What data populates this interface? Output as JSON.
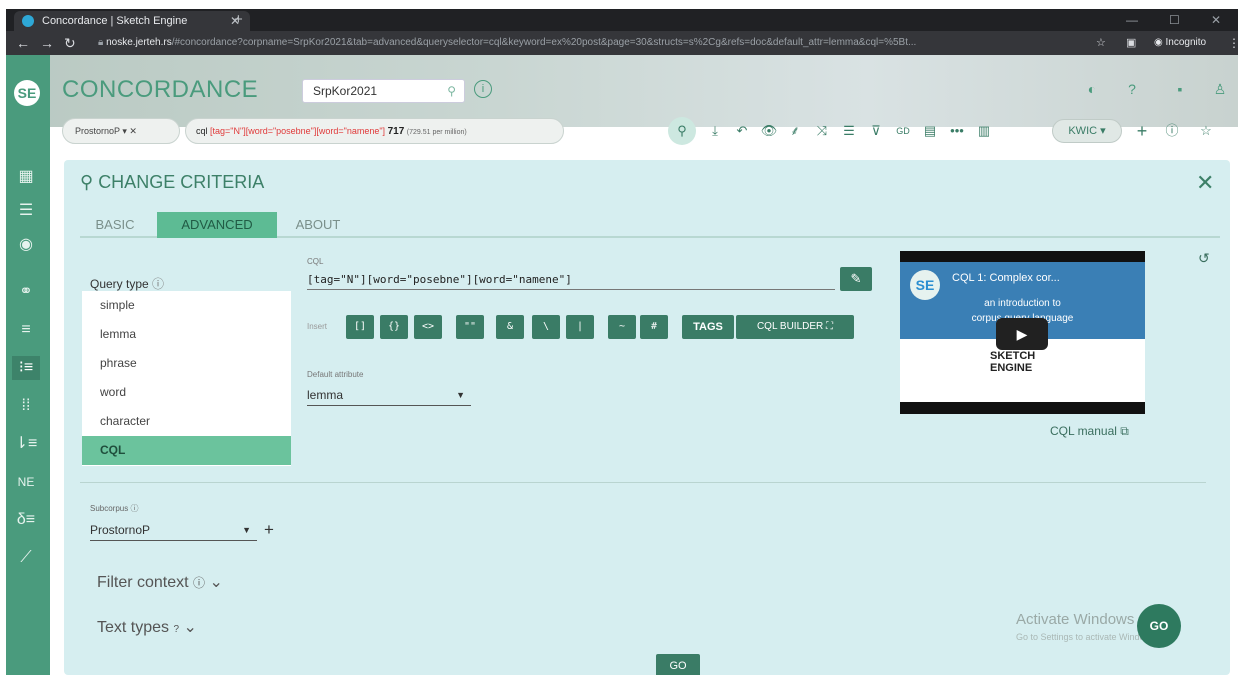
{
  "browser": {
    "tab_title": "Concordance | Sketch Engine",
    "url_host": "noske.jerteh.rs",
    "url_rest": "/#concordance?corpname=SrpKor2021&tab=advanced&queryselector=cql&keyword=ex%20post&page=30&structs=s%2Cg&refs=doc&default_attr=lemma&cql=%5Bt...",
    "incognito_label": "Incognito"
  },
  "header": {
    "title": "CONCORDANCE",
    "corpus": "SrpKor2021"
  },
  "chips": {
    "subcorpus": "ProstornoP",
    "cql_prefix": "cql",
    "cql_query": "[tag=\"N\"][word=\"posebne\"][word=\"namene\"]",
    "count": "717",
    "per_million": "(729.51 per million)"
  },
  "toolbar": {
    "view": "KWIC"
  },
  "panel": {
    "heading": "CHANGE CRITERIA",
    "tabs": [
      "BASIC",
      "ADVANCED",
      "ABOUT"
    ],
    "query_type_label": "Query type",
    "query_types": [
      "simple",
      "lemma",
      "phrase",
      "word",
      "character",
      "CQL"
    ],
    "selected_query_type": "CQL",
    "cql_label": "CQL",
    "cql_value": "[tag=\"N\"][word=\"posebne\"][word=\"namene\"]",
    "insert_label": "Insert",
    "insert_buttons": [
      "[]",
      "{}",
      "<>",
      "\"\"",
      "&",
      "\\",
      "|",
      "~",
      "#"
    ],
    "tags_button": "TAGS",
    "cql_builder_button": "CQL BUILDER",
    "default_attr_label": "Default attribute",
    "default_attr_value": "lemma",
    "video_title": "CQL 1: Complex cor...",
    "video_intro_1": "an introduction to",
    "video_intro_2": "corpus query language",
    "video_logo_1": "SKETCH",
    "video_logo_2": "ENGINE",
    "cql_manual": "CQL manual",
    "subcorpus_label": "Subcorpus",
    "subcorpus_value": "ProstornoP",
    "filter_context": "Filter context",
    "text_types": "Text types",
    "go_button": "GO",
    "go_fab": "GO",
    "watermark_1": "Activate Windows",
    "watermark_2": "Go to Settings to activate Windows."
  },
  "colors": {
    "accent": "#4a9b7d",
    "dark_accent": "#3a7c66",
    "panel_bg": "#d6eef0",
    "query_red": "#e03a3a"
  }
}
